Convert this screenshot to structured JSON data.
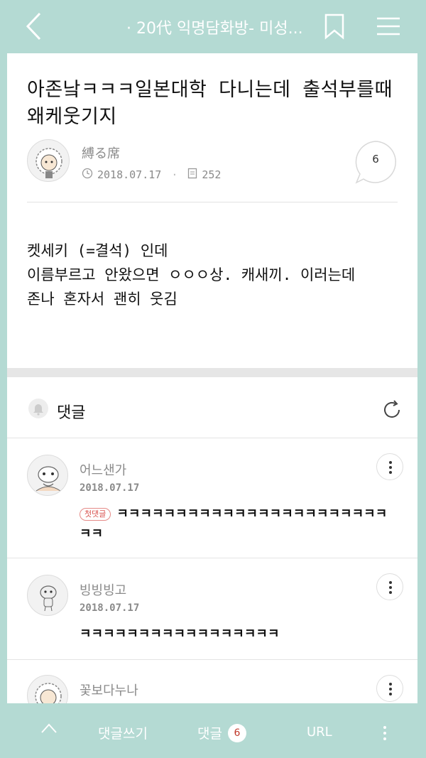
{
  "header": {
    "title": "· 20代 익명담화방- 미성...",
    "back_icon": "chevron-left-icon",
    "bookmark_icon": "bookmark-icon",
    "menu_icon": "hamburger-menu-icon"
  },
  "post": {
    "title": "아존낰ㅋㅋㅋ일본대학 다니는데 출석부를때 왜케웃기지",
    "author": "縛る席",
    "date": "2018.07.17",
    "views": "252",
    "comment_count": "6",
    "body": [
      "켓세키 (=결석) 인데",
      "이름부르고 안왔으면 ㅇㅇㅇ상. 캐새끼. 이러는데",
      "존나 혼자서 괜히 웃김"
    ]
  },
  "comments_section": {
    "label": "댓글",
    "items": [
      {
        "author": "어느샌가",
        "date": "2018.07.17",
        "badge": "첫댓글",
        "text": "ㅋㅋㅋㅋㅋㅋㅋㅋㅋㅋㅋㅋㅋㅋㅋㅋㅋㅋㅋㅋㅋㅋㅋㅋㅋ"
      },
      {
        "author": "빙빙빙고",
        "date": "2018.07.17",
        "text": "ㅋㅋㅋㅋㅋㅋㅋㅋㅋㅋㅋㅋㅋㅋㅋㅋㅋ"
      },
      {
        "author": "꽃보다누나"
      }
    ]
  },
  "bottom_bar": {
    "write_label": "댓글쓰기",
    "comments_label": "댓글",
    "comments_count": "6",
    "url_label": "URL"
  },
  "colors": {
    "accent": "#b4dad3",
    "badge_red": "#d9534f"
  }
}
